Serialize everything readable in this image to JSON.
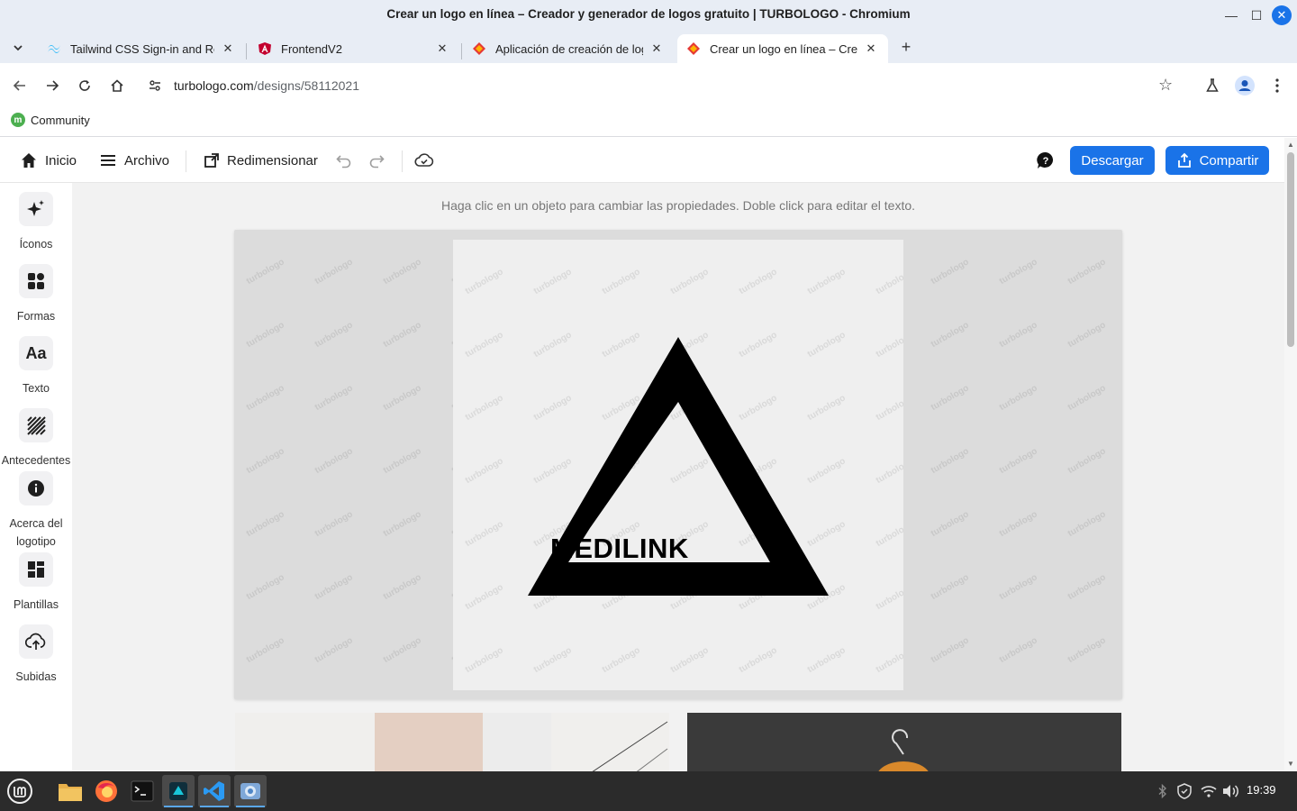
{
  "window": {
    "title": "Crear un logo en línea – Creador y generador de logos gratuito | TURBOLOGO - Chromium",
    "minimize": "—",
    "maximize": "☐",
    "close": "✕"
  },
  "tabs": [
    {
      "label": "Tailwind CSS Sign-in and Reg",
      "icon": "tailwind-icon",
      "active": false,
      "close": "✕"
    },
    {
      "label": "FrontendV2",
      "icon": "angular-icon",
      "active": false,
      "close": "✕"
    },
    {
      "label": "Aplicación de creación de log",
      "icon": "turbologo-icon",
      "active": false,
      "close": "✕"
    },
    {
      "label": "Crear un logo en línea – Crea",
      "icon": "turbologo-icon",
      "active": true,
      "close": "✕"
    }
  ],
  "new_tab": "+",
  "address": {
    "domain": "turbologo.com",
    "path": "/designs/58112021"
  },
  "bookmarks": [
    {
      "label": "Community",
      "icon_letter": "m"
    }
  ],
  "toolbar": {
    "home": "Inicio",
    "file": "Archivo",
    "resize": "Redimensionar",
    "download": "Descargar",
    "share": "Compartir"
  },
  "sidebar": {
    "items": [
      {
        "label": "Íconos",
        "icon": "sparkle-icon"
      },
      {
        "label": "Formas",
        "icon": "shapes-icon"
      },
      {
        "label": "Texto",
        "icon": "text-icon",
        "glyph": "Aa"
      },
      {
        "label": "Antecedentes",
        "icon": "stripes-icon"
      },
      {
        "label": "Acerca del logotipo",
        "icon": "info-icon"
      },
      {
        "label": "Plantillas",
        "icon": "templates-icon"
      },
      {
        "label": "Subidas",
        "icon": "upload-icon"
      }
    ]
  },
  "workspace": {
    "hint": "Haga clic en un objeto para cambiar las propiedades. Doble click para editar el texto.",
    "watermark": "turbologo",
    "logo_text": "MEDILINK",
    "colors": {
      "logo": "#000000",
      "accent": "#1a73e8",
      "canvas": "#efefef"
    }
  },
  "taskbar": {
    "apps": [
      "mint-menu-icon",
      "files-icon",
      "firefox-icon",
      "terminal-icon",
      "app-icon",
      "vscode-icon",
      "chromium-icon"
    ],
    "clock": "19:39"
  }
}
